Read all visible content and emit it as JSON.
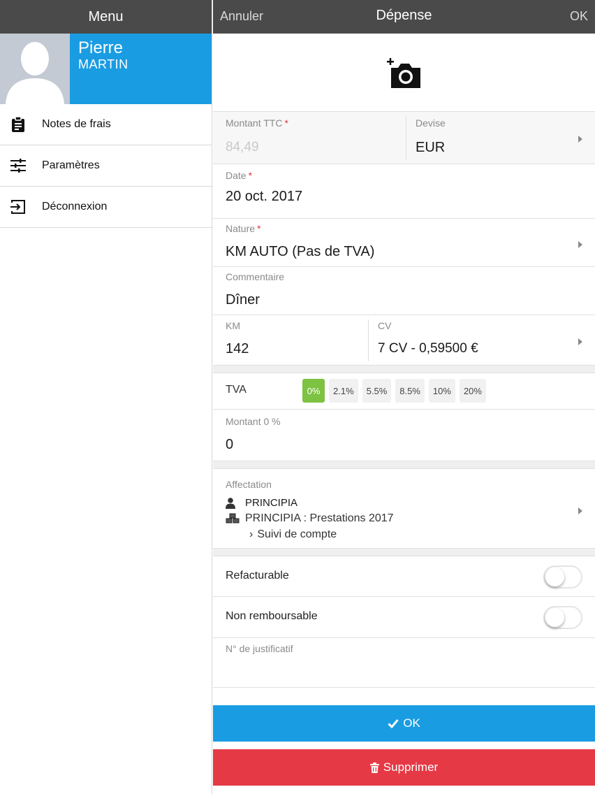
{
  "menu": {
    "title": "Menu",
    "profile": {
      "first_name": "Pierre",
      "last_name": "MARTIN"
    },
    "items": [
      {
        "label": "Notes de frais",
        "icon": "clipboard-icon"
      },
      {
        "label": "Paramètres",
        "icon": "sliders-icon"
      },
      {
        "label": "Déconnexion",
        "icon": "sign-out-icon"
      }
    ]
  },
  "nav": {
    "cancel": "Annuler",
    "title": "Dépense",
    "ok": "OK"
  },
  "photo": {
    "icon": "add-photo-icon"
  },
  "fields": {
    "montant": {
      "label": "Montant TTC",
      "required": "*",
      "value": "84,49"
    },
    "devise": {
      "label": "Devise",
      "value": "EUR"
    },
    "date": {
      "label": "Date",
      "required": "*",
      "value": "20 oct. 2017"
    },
    "nature": {
      "label": "Nature",
      "required": "*",
      "value": "KM AUTO (Pas de TVA)"
    },
    "commentaire": {
      "label": "Commentaire",
      "value": "Dîner"
    },
    "km": {
      "label": "KM",
      "value": "142"
    },
    "cv": {
      "label": "CV",
      "value": "7 CV - 0,59500 €"
    },
    "tva": {
      "label": "TVA",
      "options": [
        "0%",
        "2.1%",
        "5.5%",
        "8.5%",
        "10%",
        "20%"
      ],
      "selected": "0%"
    },
    "montant0": {
      "label": "Montant 0 %",
      "value": "0"
    },
    "affectation": {
      "label": "Affectation",
      "client": "PRINCIPIA",
      "project": "PRINCIPIA : Prestations 2017",
      "task": "Suivi de compte"
    },
    "refacturable": {
      "label": "Refacturable",
      "on": false
    },
    "non_remboursable": {
      "label": "Non remboursable",
      "on": false
    },
    "justificatif": {
      "label": "N° de justificatif",
      "value": ""
    }
  },
  "buttons": {
    "ok": "OK",
    "delete": "Supprimer"
  },
  "colors": {
    "accent": "#1a9ce2",
    "danger": "#e53945",
    "tva_active": "#7dc242",
    "header": "#4a4a4a",
    "required": "#e0393e"
  }
}
